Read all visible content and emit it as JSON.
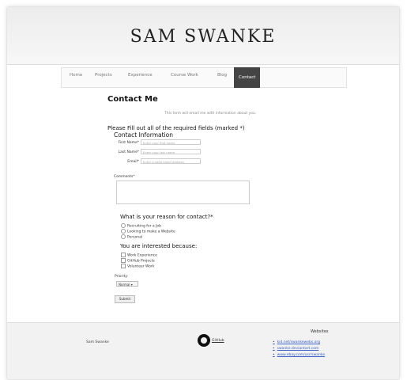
{
  "site": {
    "title": "SAM SWANKE"
  },
  "nav": {
    "items": [
      {
        "label": "Home"
      },
      {
        "label": "Projects"
      },
      {
        "label": "Experience"
      },
      {
        "label": "Course Work"
      },
      {
        "label": "Blog"
      },
      {
        "label": "Contact"
      }
    ],
    "active": "Contact"
  },
  "page": {
    "heading": "Contact Me",
    "intro": "This form will email me with information about you.",
    "required_note": "Please Fill out all of the required fields (marked *)",
    "section_contact": "Contact Information",
    "fields": [
      {
        "label": "First Name*",
        "placeholder": "Enter your first name"
      },
      {
        "label": "Last Name*",
        "placeholder": "Enter your last name"
      },
      {
        "label": "Email*",
        "placeholder": "Enter a valid email address"
      }
    ],
    "comments_label": "Comments*",
    "reason_title": "What is your reason for contact?*",
    "reasons": [
      "Recruiting for a Job",
      "Looking to make a Website",
      "Personal"
    ],
    "interest_title": "You are interested because:",
    "interests": [
      "Work Experience",
      "GitHub Projects",
      "Volunteer Work"
    ],
    "priority_label": "Priority:",
    "priority_value": "Normal",
    "submit_label": "Submit"
  },
  "footer": {
    "name": "Sam Swanke",
    "github_label": "GitHub",
    "websites_title": "Websites",
    "links": [
      "kid.net/swankewebs.org",
      "swanke.deviantart.com",
      "www.ebay.com/usr/swanke"
    ]
  },
  "colors": {
    "nav_active_bg": "#444444",
    "link": "#3b62c9"
  }
}
